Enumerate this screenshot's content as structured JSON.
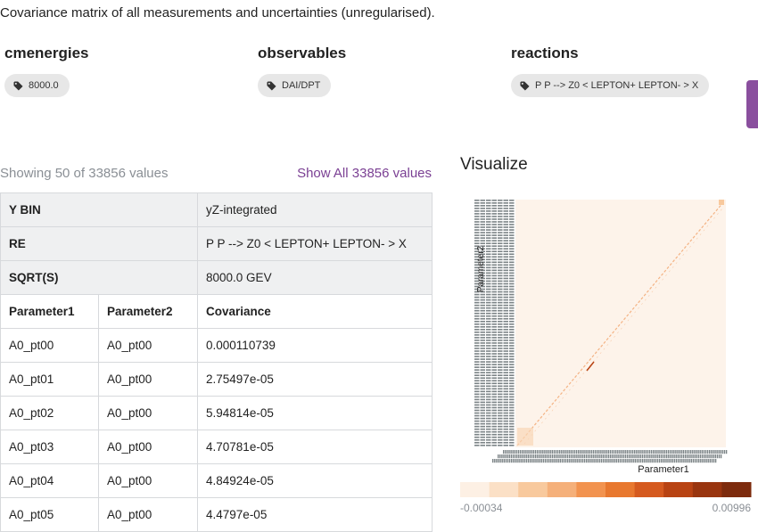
{
  "description": "Covariance matrix of all measurements and uncertainties (unregularised).",
  "keywords": [
    {
      "title": "cmenergies",
      "value": "8000.0"
    },
    {
      "title": "observables",
      "value": "DAI/DPT"
    },
    {
      "title": "reactions",
      "value": "P P --> Z0 < LEPTON+ LEPTON- > X"
    }
  ],
  "table": {
    "showing": "Showing 50 of 33856 values",
    "show_all": "Show All 33856 values",
    "meta": [
      {
        "label": "Y BIN",
        "value": "yZ-integrated"
      },
      {
        "label": "RE",
        "value": "P P --> Z0 < LEPTON+ LEPTON- > X"
      },
      {
        "label": "SQRT(S)",
        "value": "8000.0 GEV"
      }
    ],
    "headers": [
      "Parameter1",
      "Parameter2",
      "Covariance"
    ],
    "rows": [
      [
        "A0_pt00",
        "A0_pt00",
        "0.000110739"
      ],
      [
        "A0_pt01",
        "A0_pt00",
        "2.75497e-05"
      ],
      [
        "A0_pt02",
        "A0_pt00",
        "5.94814e-05"
      ],
      [
        "A0_pt03",
        "A0_pt00",
        "4.70781e-05"
      ],
      [
        "A0_pt04",
        "A0_pt00",
        "4.84924e-05"
      ],
      [
        "A0_pt05",
        "A0_pt00",
        "4.4797e-05"
      ]
    ]
  },
  "visualize": {
    "title": "Visualize",
    "xlabel": "Parameter1",
    "ylabel": "Parameter2",
    "cbar_min": "-0.00034",
    "cbar_max": "0.00996",
    "colors": [
      "#fdf0e4",
      "#fbe0c6",
      "#f8c99d",
      "#f5b07a",
      "#f2934f",
      "#e8782f",
      "#d55a1f",
      "#b84313",
      "#99350f",
      "#7d2b0d"
    ],
    "background": "#fdf3ea",
    "diagonal_color": "#f2a36a"
  },
  "chart_data": {
    "type": "heatmap",
    "xlabel": "Parameter1",
    "ylabel": "Parameter2",
    "colorbar_range": [
      -0.00034,
      0.00996
    ]
  }
}
